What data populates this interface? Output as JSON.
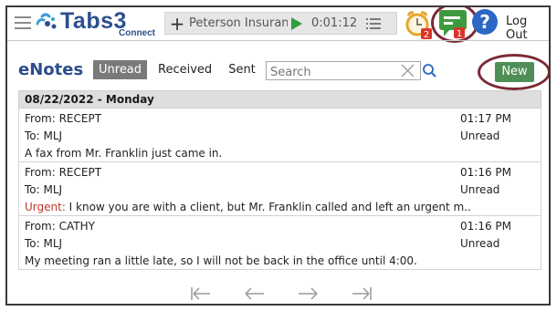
{
  "app": {
    "brand": "Tabs3",
    "brand_sub": "Connect",
    "logout_label": "Log Out",
    "accent": "#2c4f8e",
    "highlight_ring": "#7d2a36"
  },
  "timer": {
    "client": "Peterson Insuranc",
    "elapsed": "0:01:12",
    "play_color": "#2e9e3e"
  },
  "badges": {
    "alarm_count": "2",
    "chat_count": "1"
  },
  "enotes": {
    "title": "eNotes",
    "tabs": [
      {
        "label": "Unread",
        "active": true
      },
      {
        "label": "Received",
        "active": false
      },
      {
        "label": "Sent",
        "active": false
      }
    ],
    "search_placeholder": "Search",
    "new_label": "New",
    "new_color": "#4e8f57"
  },
  "list": {
    "date_header": "08/22/2022 - Monday",
    "notes": [
      {
        "from": "From: RECEPT",
        "to": "To: MLJ",
        "time": "01:17 PM",
        "status": "Unread",
        "prefix": "",
        "message": "A fax from Mr. Franklin just came in."
      },
      {
        "from": "From: RECEPT",
        "to": "To: MLJ",
        "time": "01:16 PM",
        "status": "Unread",
        "prefix": "Urgent:",
        "message": " I know you are with a client, but Mr. Franklin called and left an urgent m..."
      },
      {
        "from": "From: CATHY",
        "to": "To: MLJ",
        "time": "01:16 PM",
        "status": "Unread",
        "prefix": "",
        "message": "My meeting ran a little late, so I will not be back in the office until 4:00."
      }
    ]
  },
  "pager": {
    "icons": [
      "first-page-icon",
      "previous-page-icon",
      "next-page-icon",
      "last-page-icon"
    ]
  }
}
